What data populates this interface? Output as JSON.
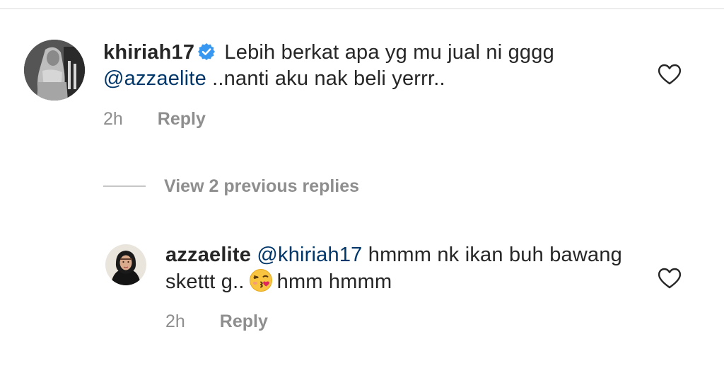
{
  "comment": {
    "username": "khiriah17",
    "verified": true,
    "text_before_mention": "Lebih berkat apa yg mu jual ni gggg",
    "mention": "@azzaelite",
    "text_after_mention": "..nanti aku nak beli yerrr..",
    "time": "2h",
    "reply_label": "Reply",
    "like_icon": "heart-outline-icon"
  },
  "view_replies_label": "View 2 previous replies",
  "reply": {
    "username": "azzaelite",
    "mention": "@khiriah17",
    "text_before_emoji": "hmmm nk ikan buh bawang skettt g..",
    "emoji": "face-blowing-kiss",
    "text_after_emoji": "hmm hmmm",
    "time": "2h",
    "reply_label": "Reply",
    "like_icon": "heart-outline-icon"
  },
  "colors": {
    "text": "#262626",
    "secondary": "#8e8e8e",
    "mention": "#00376b",
    "verified_blue": "#3897f0",
    "divider": "#dbdbdb"
  }
}
